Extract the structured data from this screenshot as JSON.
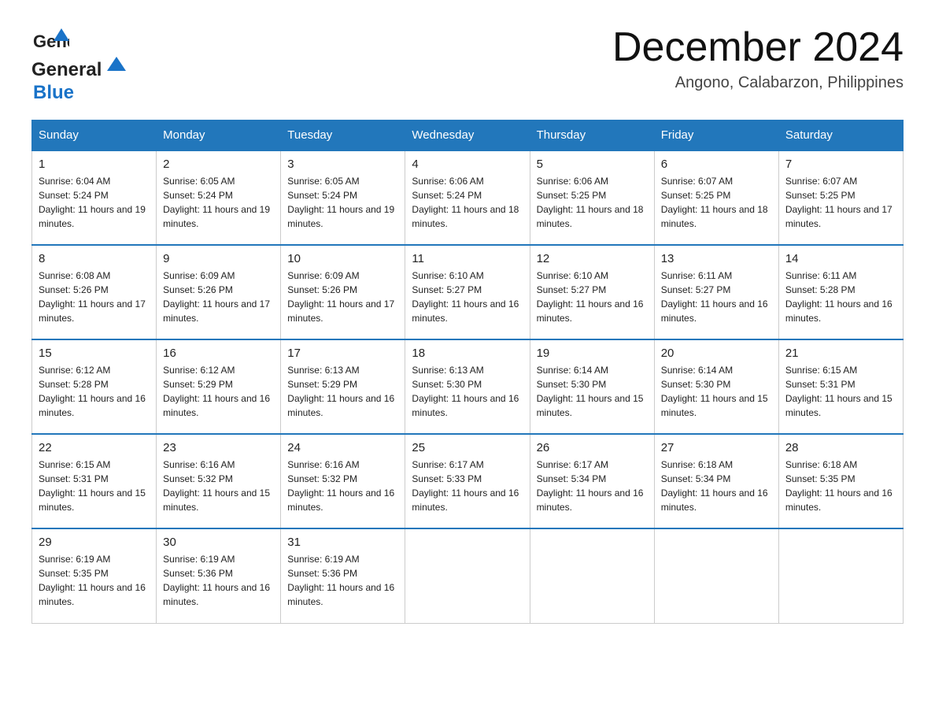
{
  "header": {
    "logo_general": "General",
    "logo_blue": "Blue",
    "title": "December 2024",
    "subtitle": "Angono, Calabarzon, Philippines"
  },
  "calendar": {
    "days": [
      "Sunday",
      "Monday",
      "Tuesday",
      "Wednesday",
      "Thursday",
      "Friday",
      "Saturday"
    ],
    "weeks": [
      [
        {
          "num": "1",
          "sunrise": "6:04 AM",
          "sunset": "5:24 PM",
          "daylight": "11 hours and 19 minutes."
        },
        {
          "num": "2",
          "sunrise": "6:05 AM",
          "sunset": "5:24 PM",
          "daylight": "11 hours and 19 minutes."
        },
        {
          "num": "3",
          "sunrise": "6:05 AM",
          "sunset": "5:24 PM",
          "daylight": "11 hours and 19 minutes."
        },
        {
          "num": "4",
          "sunrise": "6:06 AM",
          "sunset": "5:24 PM",
          "daylight": "11 hours and 18 minutes."
        },
        {
          "num": "5",
          "sunrise": "6:06 AM",
          "sunset": "5:25 PM",
          "daylight": "11 hours and 18 minutes."
        },
        {
          "num": "6",
          "sunrise": "6:07 AM",
          "sunset": "5:25 PM",
          "daylight": "11 hours and 18 minutes."
        },
        {
          "num": "7",
          "sunrise": "6:07 AM",
          "sunset": "5:25 PM",
          "daylight": "11 hours and 17 minutes."
        }
      ],
      [
        {
          "num": "8",
          "sunrise": "6:08 AM",
          "sunset": "5:26 PM",
          "daylight": "11 hours and 17 minutes."
        },
        {
          "num": "9",
          "sunrise": "6:09 AM",
          "sunset": "5:26 PM",
          "daylight": "11 hours and 17 minutes."
        },
        {
          "num": "10",
          "sunrise": "6:09 AM",
          "sunset": "5:26 PM",
          "daylight": "11 hours and 17 minutes."
        },
        {
          "num": "11",
          "sunrise": "6:10 AM",
          "sunset": "5:27 PM",
          "daylight": "11 hours and 16 minutes."
        },
        {
          "num": "12",
          "sunrise": "6:10 AM",
          "sunset": "5:27 PM",
          "daylight": "11 hours and 16 minutes."
        },
        {
          "num": "13",
          "sunrise": "6:11 AM",
          "sunset": "5:27 PM",
          "daylight": "11 hours and 16 minutes."
        },
        {
          "num": "14",
          "sunrise": "6:11 AM",
          "sunset": "5:28 PM",
          "daylight": "11 hours and 16 minutes."
        }
      ],
      [
        {
          "num": "15",
          "sunrise": "6:12 AM",
          "sunset": "5:28 PM",
          "daylight": "11 hours and 16 minutes."
        },
        {
          "num": "16",
          "sunrise": "6:12 AM",
          "sunset": "5:29 PM",
          "daylight": "11 hours and 16 minutes."
        },
        {
          "num": "17",
          "sunrise": "6:13 AM",
          "sunset": "5:29 PM",
          "daylight": "11 hours and 16 minutes."
        },
        {
          "num": "18",
          "sunrise": "6:13 AM",
          "sunset": "5:30 PM",
          "daylight": "11 hours and 16 minutes."
        },
        {
          "num": "19",
          "sunrise": "6:14 AM",
          "sunset": "5:30 PM",
          "daylight": "11 hours and 15 minutes."
        },
        {
          "num": "20",
          "sunrise": "6:14 AM",
          "sunset": "5:30 PM",
          "daylight": "11 hours and 15 minutes."
        },
        {
          "num": "21",
          "sunrise": "6:15 AM",
          "sunset": "5:31 PM",
          "daylight": "11 hours and 15 minutes."
        }
      ],
      [
        {
          "num": "22",
          "sunrise": "6:15 AM",
          "sunset": "5:31 PM",
          "daylight": "11 hours and 15 minutes."
        },
        {
          "num": "23",
          "sunrise": "6:16 AM",
          "sunset": "5:32 PM",
          "daylight": "11 hours and 15 minutes."
        },
        {
          "num": "24",
          "sunrise": "6:16 AM",
          "sunset": "5:32 PM",
          "daylight": "11 hours and 16 minutes."
        },
        {
          "num": "25",
          "sunrise": "6:17 AM",
          "sunset": "5:33 PM",
          "daylight": "11 hours and 16 minutes."
        },
        {
          "num": "26",
          "sunrise": "6:17 AM",
          "sunset": "5:34 PM",
          "daylight": "11 hours and 16 minutes."
        },
        {
          "num": "27",
          "sunrise": "6:18 AM",
          "sunset": "5:34 PM",
          "daylight": "11 hours and 16 minutes."
        },
        {
          "num": "28",
          "sunrise": "6:18 AM",
          "sunset": "5:35 PM",
          "daylight": "11 hours and 16 minutes."
        }
      ],
      [
        {
          "num": "29",
          "sunrise": "6:19 AM",
          "sunset": "5:35 PM",
          "daylight": "11 hours and 16 minutes."
        },
        {
          "num": "30",
          "sunrise": "6:19 AM",
          "sunset": "5:36 PM",
          "daylight": "11 hours and 16 minutes."
        },
        {
          "num": "31",
          "sunrise": "6:19 AM",
          "sunset": "5:36 PM",
          "daylight": "11 hours and 16 minutes."
        },
        null,
        null,
        null,
        null
      ]
    ]
  }
}
